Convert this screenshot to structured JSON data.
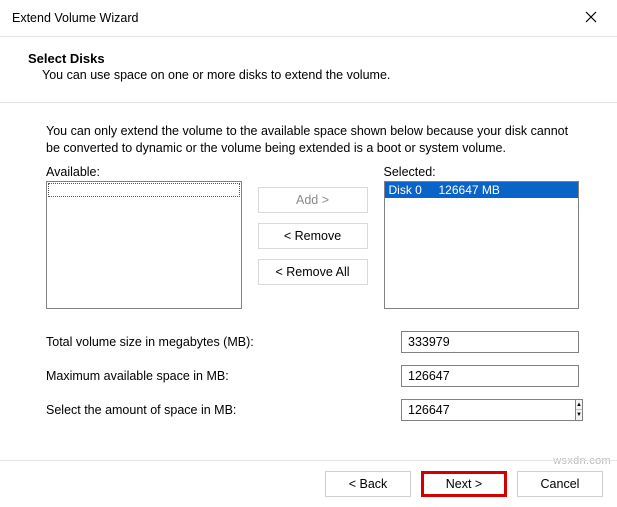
{
  "window": {
    "title": "Extend Volume Wizard"
  },
  "header": {
    "title": "Select Disks",
    "subtitle": "You can use space on one or more disks to extend the volume."
  },
  "body": {
    "explanation": "You can only extend the volume to the available space shown below because your disk cannot be converted to dynamic or the volume being extended is a boot or system volume.",
    "available_label": "Available:",
    "selected_label": "Selected:",
    "available_items": [],
    "selected_items": [
      {
        "text": "Disk 0     126647 MB"
      }
    ],
    "buttons": {
      "add": "Add >",
      "remove": "< Remove",
      "remove_all": "< Remove All"
    },
    "fields": {
      "total_label": "Total volume size in megabytes (MB):",
      "total_value": "333979",
      "max_label": "Maximum available space in MB:",
      "max_value": "126647",
      "amount_label": "Select the amount of space in MB:",
      "amount_value": "126647"
    }
  },
  "footer": {
    "back": "< Back",
    "next": "Next >",
    "cancel": "Cancel"
  },
  "watermark": "wsxdn.com"
}
